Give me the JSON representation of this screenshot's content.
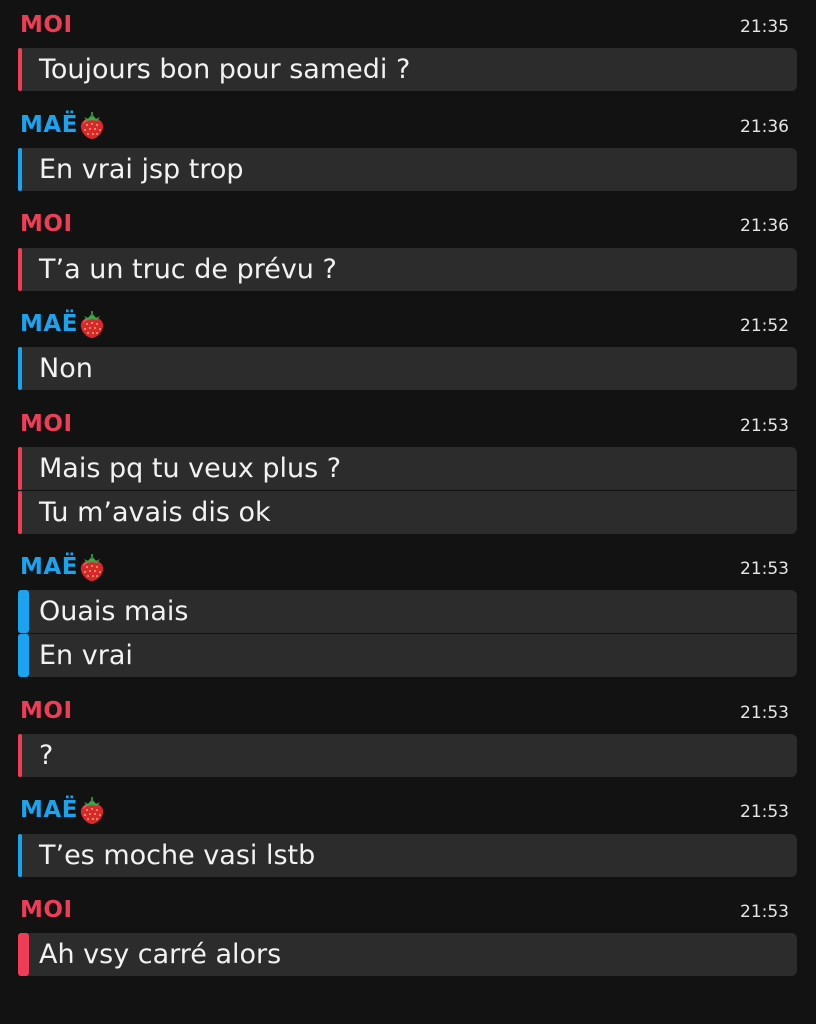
{
  "colors": {
    "background": "#121212",
    "bubble": "#2c2c2c",
    "me_accent": "#ef3d57",
    "them_accent": "#1aa3ef"
  },
  "messages": [
    {
      "sender": "MOI",
      "emoji": "",
      "time": "21:35",
      "lines": [
        "Toujours bon pour samedi ?"
      ]
    },
    {
      "sender": "MAË",
      "emoji": "strawberry-icon",
      "time": "21:36",
      "lines": [
        "En vrai jsp trop"
      ]
    },
    {
      "sender": "MOI",
      "emoji": "",
      "time": "21:36",
      "lines": [
        "T’a un truc de prévu ?"
      ]
    },
    {
      "sender": "MAË",
      "emoji": "strawberry-icon",
      "time": "21:52",
      "lines": [
        "Non"
      ]
    },
    {
      "sender": "MOI",
      "emoji": "",
      "time": "21:53",
      "lines": [
        "Mais pq tu veux plus ?",
        "Tu m’avais dis ok"
      ]
    },
    {
      "sender": "MAË",
      "emoji": "strawberry-icon",
      "time": "21:53",
      "lines": [
        "Ouais mais",
        "En vrai"
      ]
    },
    {
      "sender": "MOI",
      "emoji": "",
      "time": "21:53",
      "lines": [
        "?"
      ]
    },
    {
      "sender": "MAË",
      "emoji": "strawberry-icon",
      "time": "21:53",
      "lines": [
        "T’es moche vasi lstb"
      ]
    },
    {
      "sender": "MOI",
      "emoji": "",
      "time": "21:53",
      "lines": [
        "Ah vsy carré alors"
      ]
    }
  ]
}
